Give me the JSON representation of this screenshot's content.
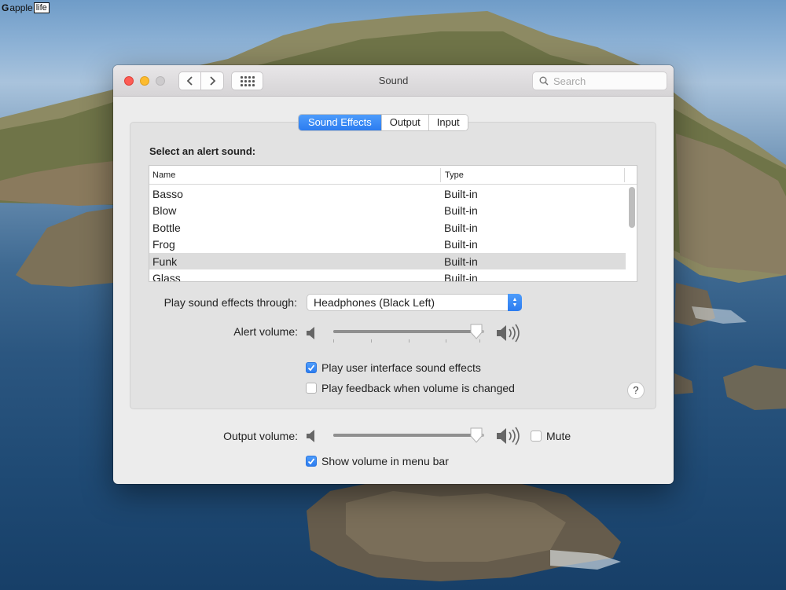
{
  "watermark": {
    "mark": "G",
    "brand": "apple",
    "brand2": "life"
  },
  "window": {
    "title": "Sound"
  },
  "toolbar": {
    "search_placeholder": "Search"
  },
  "tabs": [
    {
      "label": "Sound Effects",
      "active": true
    },
    {
      "label": "Output",
      "active": false
    },
    {
      "label": "Input",
      "active": false
    }
  ],
  "alerts": {
    "heading": "Select an alert sound:",
    "columns": {
      "name": "Name",
      "type": "Type"
    },
    "rows": [
      {
        "name": "Basso",
        "type": "Built-in"
      },
      {
        "name": "Blow",
        "type": "Built-in"
      },
      {
        "name": "Bottle",
        "type": "Built-in"
      },
      {
        "name": "Frog",
        "type": "Built-in"
      },
      {
        "name": "Funk",
        "type": "Built-in",
        "selected": true
      },
      {
        "name": "Glass",
        "type": "Built-in"
      }
    ]
  },
  "play_through": {
    "label": "Play sound effects through:",
    "value": "Headphones (Black Left)"
  },
  "alert_volume": {
    "label": "Alert volume:",
    "level": 0.95
  },
  "options": {
    "ui_sounds": {
      "label": "Play user interface sound effects",
      "checked": true
    },
    "feedback": {
      "label": "Play feedback when volume is changed",
      "checked": false
    }
  },
  "help": "?",
  "output_volume": {
    "label": "Output volume:",
    "level": 0.95,
    "mute_label": "Mute",
    "muted": false
  },
  "menu_bar": {
    "label": "Show volume in menu bar",
    "checked": true
  },
  "colors": {
    "accent": "#2c7cf0",
    "selected_row": "#dcdcdc"
  }
}
